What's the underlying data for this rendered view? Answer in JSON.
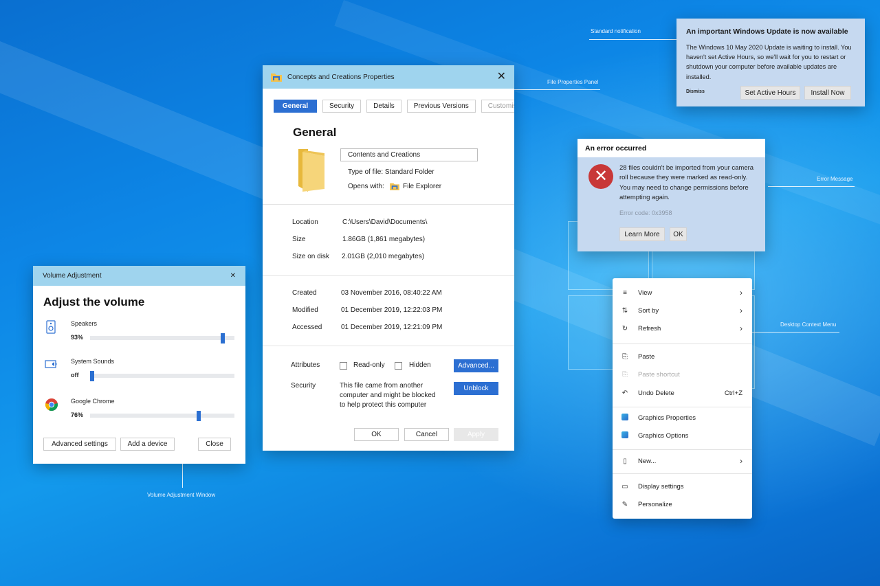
{
  "desktop": {
    "callouts": {
      "notification": "Standard notification",
      "properties": "File Properties Panel",
      "error": "Error Message",
      "context_menu": "Desktop Context Menu",
      "volume": "Volume Adjustment Window"
    }
  },
  "volume": {
    "title": "Volume Adjustment",
    "heading": "Adjust the volume",
    "items": [
      {
        "name": "Speakers",
        "value_text": "93%",
        "level": 0.93
      },
      {
        "name": "System Sounds",
        "value_text": "off",
        "level": 0.0
      },
      {
        "name": "Google Chrome",
        "value_text": "76%",
        "level": 0.76
      }
    ],
    "buttons": {
      "advanced": "Advanced settings",
      "add_device": "Add a device",
      "close": "Close"
    }
  },
  "properties": {
    "title": "Concepts and Creations Properties",
    "tabs": [
      "General",
      "Security",
      "Details",
      "Previous Versions",
      "Customise"
    ],
    "heading": "General",
    "name_value": "Contents and Creations",
    "type_of_file": "Type of file: Standard Folder",
    "opens_with_label": "Opens with:",
    "opens_with_app": "File Explorer",
    "location_label": "Location",
    "location_value": "C:\\Users\\David\\Documents\\",
    "size_label": "Size",
    "size_value": "1.86GB (1,861 megabytes)",
    "size_on_disk_label": "Size on disk",
    "size_on_disk_value": "2.01GB (2,010 megabytes)",
    "created_label": "Created",
    "created_value": "03 November 2016, 08:40:22 AM",
    "modified_label": "Modified",
    "modified_value": "01 December 2019, 12:22:03 PM",
    "accessed_label": "Accessed",
    "accessed_value": "01 December 2019, 12:21:09 PM",
    "attributes_label": "Attributes",
    "readonly_label": "Read-only",
    "hidden_label": "Hidden",
    "advanced_button": "Advanced...",
    "security_label": "Security",
    "security_text_1": "This file came from another",
    "security_text_2": "computer and might be blocked",
    "security_text_3": "to help protect this computer",
    "unblock_button": "Unblock",
    "ok_button": "OK",
    "cancel_button": "Cancel",
    "apply_button": "Apply"
  },
  "notification": {
    "title": "An important Windows Update is now available",
    "body": "The Windows 10 May 2020 Update is waiting to install. You haven't set Active Hours, so we'll wait for you to restart or shutdown your computer before available updates are installed.",
    "dismiss": "Dismiss",
    "set_active_hours": "Set Active Hours",
    "install_now": "Install Now"
  },
  "error": {
    "title": "An error occurred",
    "body": "28 files couldn't be imported from your camera roll because they were marked as read-only. You may need to change permissions before attempting again.",
    "code": "Error code: 0x3958",
    "learn_more": "Learn More",
    "ok": "OK"
  },
  "context_menu": {
    "items": [
      {
        "label": "View",
        "icon": "view-icon",
        "submenu": true
      },
      {
        "label": "Sort by",
        "icon": "sort-icon",
        "submenu": true
      },
      {
        "label": "Refresh",
        "icon": "refresh-icon",
        "submenu": true
      },
      {
        "label": "Paste",
        "icon": "paste-icon"
      },
      {
        "label": "Paste shortcut",
        "icon": "paste-shortcut-icon",
        "disabled": true
      },
      {
        "label": "Undo Delete",
        "icon": "undo-icon",
        "shortcut": "Ctrl+Z"
      },
      {
        "label": "Graphics Properties",
        "icon": "graphics-icon"
      },
      {
        "label": "Graphics Options",
        "icon": "graphics-icon"
      },
      {
        "label": "New...",
        "icon": "new-icon",
        "submenu": true
      },
      {
        "label": "Display settings",
        "icon": "display-icon"
      },
      {
        "label": "Personalize",
        "icon": "personalize-icon"
      }
    ]
  },
  "colors": {
    "accent": "#2c6fd2",
    "titlebar": "#9fd4ee",
    "error_red": "#c83838",
    "toast_bg": "#c6d9f0"
  }
}
